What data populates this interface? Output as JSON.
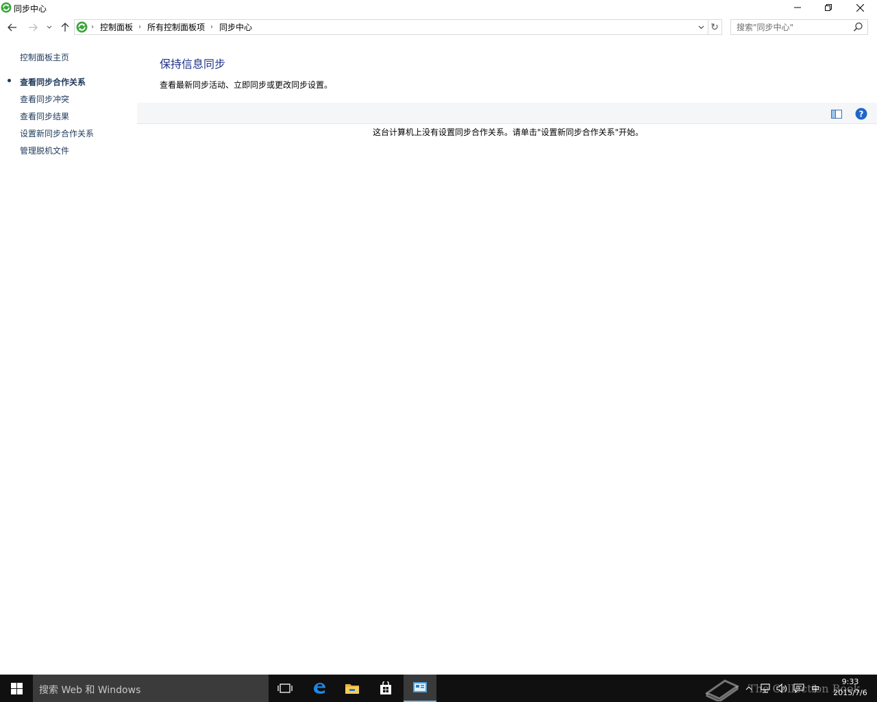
{
  "window": {
    "title": "同步中心",
    "minimize_icon": "minimize-icon",
    "maximize_icon": "restore-icon",
    "close_icon": "close-icon"
  },
  "navigation": {
    "breadcrumbs": [
      "控制面板",
      "所有控制面板项",
      "同步中心"
    ],
    "search_placeholder": "搜索\"同步中心\"",
    "refresh_glyph": "↻"
  },
  "sidebar": {
    "home_link": "控制面板主页",
    "items": [
      {
        "label": "查看同步合作关系",
        "active": true
      },
      {
        "label": "查看同步冲突",
        "active": false
      },
      {
        "label": "查看同步结果",
        "active": false
      },
      {
        "label": "设置新同步合作关系",
        "active": false
      },
      {
        "label": "管理脱机文件",
        "active": false
      }
    ]
  },
  "main": {
    "title": "保持信息同步",
    "description": "查看最新同步活动、立即同步或更改同步设置。",
    "empty_message": "这台计算机上没有设置同步合作关系。请单击\"设置新同步合作关系\"开始。"
  },
  "taskbar": {
    "search_text": "搜索 Web 和 Windows",
    "ime_label": "中",
    "time": "9:33",
    "date": "2015/7/6",
    "watermark": "The Collection Book"
  },
  "colors": {
    "link": "#1e395b",
    "title": "#1e3287",
    "taskbar": "#101010",
    "accent": "#76b9ed"
  }
}
